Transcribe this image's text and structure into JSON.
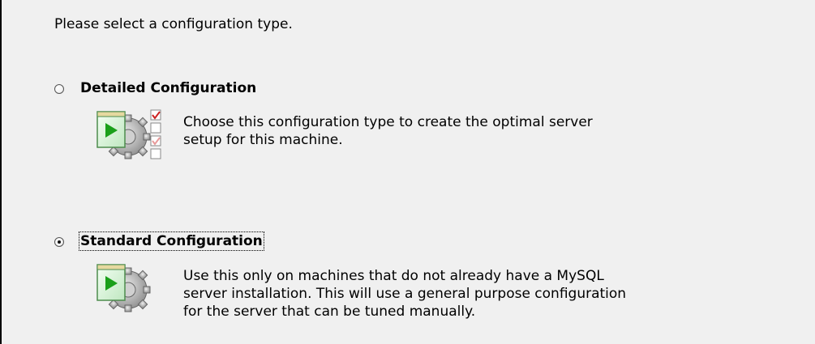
{
  "prompt": "Please select a configuration type.",
  "options": [
    {
      "label": "Detailed Configuration",
      "selected": false,
      "icon": "config-wizard-checklist-icon",
      "description_lines": [
        "Choose this configuration type to create the optimal server",
        "setup for this machine."
      ]
    },
    {
      "label": "Standard Configuration",
      "selected": true,
      "icon": "config-wizard-icon",
      "description_lines": [
        "Use this only on machines that do not already have a MySQL",
        "server installation. This will use a general purpose configuration",
        "for the server that can be tuned manually."
      ]
    }
  ],
  "colors": {
    "background": "#f0f0f0",
    "play_green": "#1aa01a",
    "check_red": "#cc2222"
  }
}
